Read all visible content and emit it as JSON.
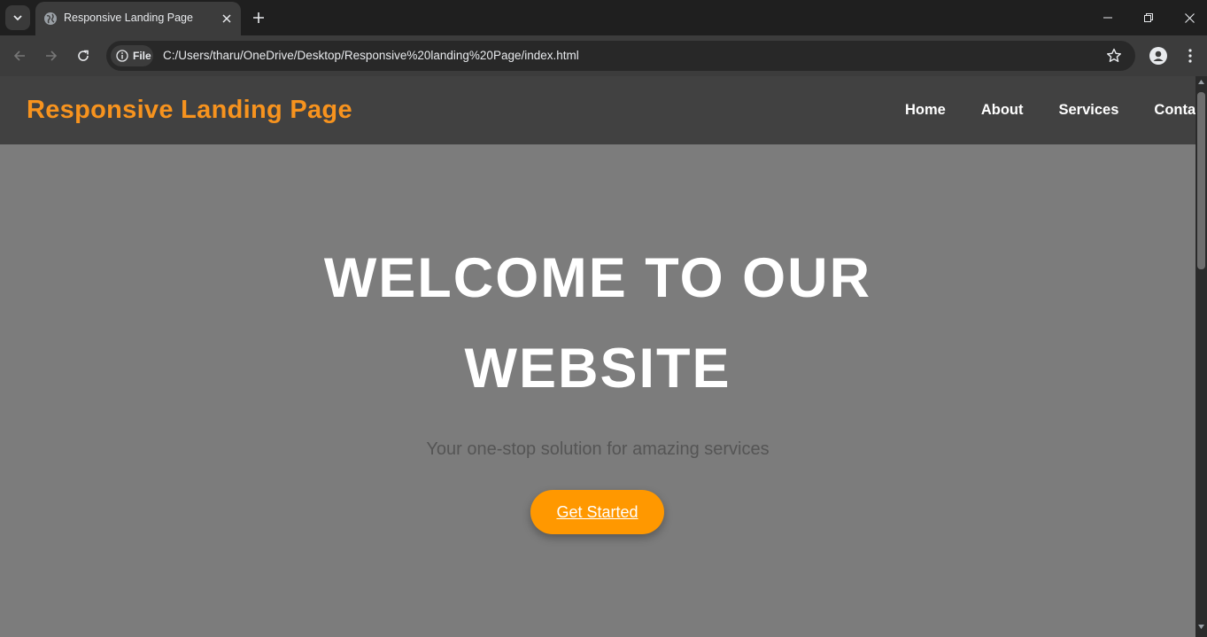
{
  "browser": {
    "tab": {
      "title": "Responsive Landing Page"
    },
    "address_bar": {
      "site_chip_label": "File",
      "url": "C:/Users/tharu/OneDrive/Desktop/Responsive%20landing%20Page/index.html"
    }
  },
  "site": {
    "logo": "Responsive Landing Page",
    "nav": [
      {
        "label": "Home"
      },
      {
        "label": "About"
      },
      {
        "label": "Services"
      },
      {
        "label": "Contact"
      }
    ],
    "hero": {
      "title": "WELCOME TO OUR WEBSITE",
      "subtitle": "Your one-stop solution for amazing services",
      "cta_label": "Get Started"
    }
  },
  "colors": {
    "accent": "#f7931e",
    "cta_background": "#ff9800",
    "header_background": "#414141",
    "hero_background": "#7c7c7c"
  }
}
